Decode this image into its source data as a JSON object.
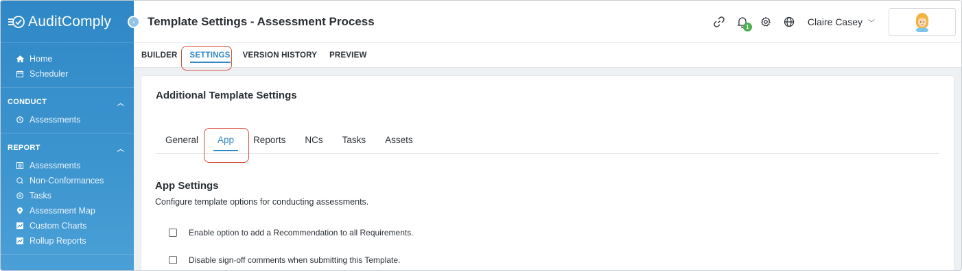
{
  "brand": {
    "name": "AuditComply"
  },
  "sidebar": {
    "top_items": [
      {
        "label": "Home",
        "icon": "home-icon"
      },
      {
        "label": "Scheduler",
        "icon": "calendar-icon"
      }
    ],
    "sections": [
      {
        "title": "CONDUCT",
        "items": [
          {
            "label": "Assessments",
            "icon": "clock-icon"
          }
        ]
      },
      {
        "title": "REPORT",
        "items": [
          {
            "label": "Assessments",
            "icon": "list-icon"
          },
          {
            "label": "Non-Conformances",
            "icon": "search-badge-icon"
          },
          {
            "label": "Tasks",
            "icon": "tasks-icon"
          },
          {
            "label": "Assessment Map",
            "icon": "map-pin-icon"
          },
          {
            "label": "Custom Charts",
            "icon": "chart-icon"
          },
          {
            "label": "Rollup Reports",
            "icon": "chart-icon"
          }
        ]
      }
    ]
  },
  "header": {
    "title": "Template Settings - Assessment Process",
    "notification_count": "1",
    "user_name": "Claire Casey"
  },
  "subtabs": [
    "BUILDER",
    "SETTINGS",
    "VERSION HISTORY",
    "PREVIEW"
  ],
  "card": {
    "title": "Additional Template Settings",
    "tabs": [
      "General",
      "App",
      "Reports",
      "NCs",
      "Tasks",
      "Assets"
    ],
    "section_title": "App Settings",
    "section_desc": "Configure template options for conducting assessments.",
    "options": [
      "Enable option to add a Recommendation to all Requirements.",
      "Disable sign-off comments when submitting this Template."
    ]
  },
  "colors": {
    "accent": "#2f88c6",
    "highlight": "#d64c3c",
    "badge": "#4caf50"
  }
}
